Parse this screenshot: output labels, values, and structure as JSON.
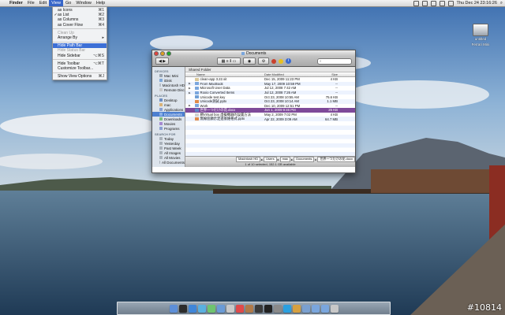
{
  "menubar": {
    "app": "Finder",
    "menus": [
      "File",
      "Edit",
      "View",
      "Go",
      "Window",
      "Help"
    ],
    "active_menu": "View",
    "clock": "Thu Dec 24  23:16:26"
  },
  "view_menu": {
    "items": [
      {
        "label": "as Icons",
        "shortcut": "⌘1",
        "checked": false,
        "disabled": false
      },
      {
        "label": "as List",
        "shortcut": "⌘2",
        "checked": true,
        "disabled": false
      },
      {
        "label": "as Columns",
        "shortcut": "⌘3",
        "checked": false,
        "disabled": false
      },
      {
        "label": "as Cover Flow",
        "shortcut": "⌘4",
        "checked": false,
        "disabled": false
      },
      {
        "sep": true
      },
      {
        "label": "Clean Up",
        "shortcut": "",
        "checked": false,
        "disabled": true
      },
      {
        "label": "Arrange By",
        "shortcut": "▸",
        "checked": false,
        "disabled": false
      },
      {
        "sep": true
      },
      {
        "label": "Hide Path Bar",
        "shortcut": "",
        "checked": false,
        "disabled": false,
        "highlight": true
      },
      {
        "label": "Hide Status Bar",
        "shortcut": "",
        "checked": false,
        "disabled": true
      },
      {
        "label": "Hide Sidebar",
        "shortcut": "⌥⌘S",
        "checked": false,
        "disabled": false
      },
      {
        "sep": true
      },
      {
        "label": "Hide Toolbar",
        "shortcut": "⌥⌘T",
        "checked": false,
        "disabled": false
      },
      {
        "label": "Customize Toolbar...",
        "shortcut": "",
        "checked": false,
        "disabled": false
      },
      {
        "sep": true
      },
      {
        "label": "Show View Options",
        "shortcut": "⌘J",
        "checked": false,
        "disabled": false
      }
    ]
  },
  "window": {
    "title": "Documents",
    "path_header": "Shared Folder",
    "search_placeholder": "",
    "columns": {
      "name": "Name",
      "date": "Date Modified",
      "size": "Size"
    },
    "sidebar": [
      {
        "header": "DEVICES"
      },
      {
        "label": "Mac Mini",
        "color": "#9aa4ae"
      },
      {
        "label": "iDisk",
        "color": "#7fa8d8"
      },
      {
        "label": "Macintosh HD",
        "color": "#b8bec6"
      },
      {
        "label": "Remote Disc",
        "color": "#c8c8c8"
      },
      {
        "header": "PLACES"
      },
      {
        "label": "Desktop",
        "color": "#6d8fc4"
      },
      {
        "label": "mac",
        "color": "#d9b37a"
      },
      {
        "label": "Applications",
        "color": "#8aa0d0"
      },
      {
        "label": "Documents",
        "color": "#8ab0e6",
        "selected": true
      },
      {
        "label": "Downloads",
        "color": "#7fbf7f"
      },
      {
        "label": "Movies",
        "color": "#a58ad0"
      },
      {
        "label": "Programs",
        "color": "#8aa0d0"
      },
      {
        "header": "SEARCH FOR"
      },
      {
        "label": "Today",
        "color": "#aab2bb"
      },
      {
        "label": "Yesterday",
        "color": "#aab2bb"
      },
      {
        "label": "Past Week",
        "color": "#aab2bb"
      },
      {
        "label": "All Images",
        "color": "#aab2bb"
      },
      {
        "label": "All Movies",
        "color": "#aab2bb"
      },
      {
        "label": "All Documents",
        "color": "#aab2bb"
      }
    ],
    "files": [
      {
        "name": "clean-app 3.22.sit",
        "date": "Dec 15, 2009 11:23 PM",
        "size": "4 KB",
        "icon": "#d9c79a",
        "folder": false
      },
      {
        "name": "From MacBook",
        "date": "May 17, 2009 10:59 PM",
        "size": "--",
        "icon": "#7aa6dd",
        "folder": true
      },
      {
        "name": "Microsoft User Data",
        "date": "Jul 12, 2008 7:42 AM",
        "size": "--",
        "icon": "#7aa6dd",
        "folder": true
      },
      {
        "name": "Roxio Converted Items",
        "date": "Jul 12, 2008 7:26 AM",
        "size": "--",
        "icon": "#7aa6dd",
        "folder": true
      },
      {
        "name": "Unicode test.key",
        "date": "Oct 23, 2008 10:55 AM",
        "size": "75.6 KB",
        "icon": "#6f9fd6",
        "folder": false
      },
      {
        "name": "Unicode測試.pptx",
        "date": "Oct 23, 2008 10:14 AM",
        "size": "1.1 MB",
        "icon": "#e08a4a",
        "folder": false
      },
      {
        "name": "Work",
        "date": "Dec 10, 2009 12:51 PM",
        "size": "--",
        "icon": "#7aa6dd",
        "folder": true
      },
      {
        "name": "世界一つだけの花.docx",
        "date": "Jun 1, 2009 9:46 PM",
        "size": "25 KB",
        "icon": "#5a84c8",
        "folder": false,
        "selected": true
      },
      {
        "name": "網Virtual box 虛擬機器的設置方法",
        "date": "May 2, 2009 7:02 PM",
        "size": "4 KB",
        "icon": "#d0d0d0",
        "folder": false
      },
      {
        "name": "無線區顯示定進後維格式.pptx",
        "date": "Apr 22, 2009 3:09 AM",
        "size": "64.7 MB",
        "icon": "#e08a4a",
        "folder": false
      }
    ],
    "path_crumbs": [
      "Macintosh HD",
      "Users",
      "mac",
      "Documents",
      "世界一つだけの花.docx"
    ],
    "status": "1 of 10 selected, 152.1 GB available"
  },
  "desktop": {
    "hd_label_line1": "untitled",
    "hd_label_line2": "Ferrari Mini",
    "badge": "#10814"
  },
  "dock": {
    "icons": [
      "finder",
      "dashboard",
      "safari",
      "itunes",
      "ichat",
      "mail",
      "preview",
      "calendar",
      "address-book",
      "photo-booth",
      "terminal",
      "system-preferences",
      "skype",
      "app",
      "app",
      "folder",
      "folder",
      "trash"
    ],
    "colors": [
      "#5d8fd8",
      "#2c2c2c",
      "#3f86d9",
      "#5ab0e0",
      "#6fc46f",
      "#6a9bd6",
      "#c9c9c9",
      "#e04a4a",
      "#b07a4a",
      "#3a3a3a",
      "#222222",
      "#8a8a8a",
      "#2aa0e0",
      "#d6a040",
      "#7aa0d0",
      "#7aa6dd",
      "#7aa6dd",
      "#c8c8c8"
    ]
  }
}
